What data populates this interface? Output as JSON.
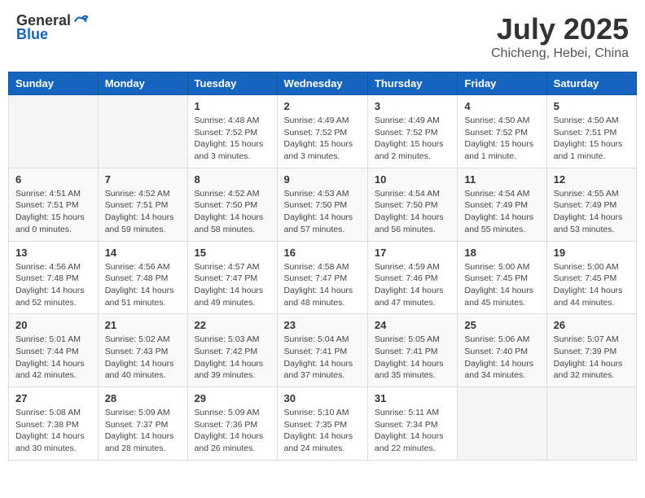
{
  "header": {
    "logo_general": "General",
    "logo_blue": "Blue",
    "month": "July 2025",
    "location": "Chicheng, Hebei, China"
  },
  "weekdays": [
    "Sunday",
    "Monday",
    "Tuesday",
    "Wednesday",
    "Thursday",
    "Friday",
    "Saturday"
  ],
  "weeks": [
    [
      {
        "day": "",
        "info": ""
      },
      {
        "day": "",
        "info": ""
      },
      {
        "day": "1",
        "info": "Sunrise: 4:48 AM\nSunset: 7:52 PM\nDaylight: 15 hours and 3 minutes."
      },
      {
        "day": "2",
        "info": "Sunrise: 4:49 AM\nSunset: 7:52 PM\nDaylight: 15 hours and 3 minutes."
      },
      {
        "day": "3",
        "info": "Sunrise: 4:49 AM\nSunset: 7:52 PM\nDaylight: 15 hours and 2 minutes."
      },
      {
        "day": "4",
        "info": "Sunrise: 4:50 AM\nSunset: 7:52 PM\nDaylight: 15 hours and 1 minute."
      },
      {
        "day": "5",
        "info": "Sunrise: 4:50 AM\nSunset: 7:51 PM\nDaylight: 15 hours and 1 minute."
      }
    ],
    [
      {
        "day": "6",
        "info": "Sunrise: 4:51 AM\nSunset: 7:51 PM\nDaylight: 15 hours and 0 minutes."
      },
      {
        "day": "7",
        "info": "Sunrise: 4:52 AM\nSunset: 7:51 PM\nDaylight: 14 hours and 59 minutes."
      },
      {
        "day": "8",
        "info": "Sunrise: 4:52 AM\nSunset: 7:50 PM\nDaylight: 14 hours and 58 minutes."
      },
      {
        "day": "9",
        "info": "Sunrise: 4:53 AM\nSunset: 7:50 PM\nDaylight: 14 hours and 57 minutes."
      },
      {
        "day": "10",
        "info": "Sunrise: 4:54 AM\nSunset: 7:50 PM\nDaylight: 14 hours and 56 minutes."
      },
      {
        "day": "11",
        "info": "Sunrise: 4:54 AM\nSunset: 7:49 PM\nDaylight: 14 hours and 55 minutes."
      },
      {
        "day": "12",
        "info": "Sunrise: 4:55 AM\nSunset: 7:49 PM\nDaylight: 14 hours and 53 minutes."
      }
    ],
    [
      {
        "day": "13",
        "info": "Sunrise: 4:56 AM\nSunset: 7:48 PM\nDaylight: 14 hours and 52 minutes."
      },
      {
        "day": "14",
        "info": "Sunrise: 4:56 AM\nSunset: 7:48 PM\nDaylight: 14 hours and 51 minutes."
      },
      {
        "day": "15",
        "info": "Sunrise: 4:57 AM\nSunset: 7:47 PM\nDaylight: 14 hours and 49 minutes."
      },
      {
        "day": "16",
        "info": "Sunrise: 4:58 AM\nSunset: 7:47 PM\nDaylight: 14 hours and 48 minutes."
      },
      {
        "day": "17",
        "info": "Sunrise: 4:59 AM\nSunset: 7:46 PM\nDaylight: 14 hours and 47 minutes."
      },
      {
        "day": "18",
        "info": "Sunrise: 5:00 AM\nSunset: 7:45 PM\nDaylight: 14 hours and 45 minutes."
      },
      {
        "day": "19",
        "info": "Sunrise: 5:00 AM\nSunset: 7:45 PM\nDaylight: 14 hours and 44 minutes."
      }
    ],
    [
      {
        "day": "20",
        "info": "Sunrise: 5:01 AM\nSunset: 7:44 PM\nDaylight: 14 hours and 42 minutes."
      },
      {
        "day": "21",
        "info": "Sunrise: 5:02 AM\nSunset: 7:43 PM\nDaylight: 14 hours and 40 minutes."
      },
      {
        "day": "22",
        "info": "Sunrise: 5:03 AM\nSunset: 7:42 PM\nDaylight: 14 hours and 39 minutes."
      },
      {
        "day": "23",
        "info": "Sunrise: 5:04 AM\nSunset: 7:41 PM\nDaylight: 14 hours and 37 minutes."
      },
      {
        "day": "24",
        "info": "Sunrise: 5:05 AM\nSunset: 7:41 PM\nDaylight: 14 hours and 35 minutes."
      },
      {
        "day": "25",
        "info": "Sunrise: 5:06 AM\nSunset: 7:40 PM\nDaylight: 14 hours and 34 minutes."
      },
      {
        "day": "26",
        "info": "Sunrise: 5:07 AM\nSunset: 7:39 PM\nDaylight: 14 hours and 32 minutes."
      }
    ],
    [
      {
        "day": "27",
        "info": "Sunrise: 5:08 AM\nSunset: 7:38 PM\nDaylight: 14 hours and 30 minutes."
      },
      {
        "day": "28",
        "info": "Sunrise: 5:09 AM\nSunset: 7:37 PM\nDaylight: 14 hours and 28 minutes."
      },
      {
        "day": "29",
        "info": "Sunrise: 5:09 AM\nSunset: 7:36 PM\nDaylight: 14 hours and 26 minutes."
      },
      {
        "day": "30",
        "info": "Sunrise: 5:10 AM\nSunset: 7:35 PM\nDaylight: 14 hours and 24 minutes."
      },
      {
        "day": "31",
        "info": "Sunrise: 5:11 AM\nSunset: 7:34 PM\nDaylight: 14 hours and 22 minutes."
      },
      {
        "day": "",
        "info": ""
      },
      {
        "day": "",
        "info": ""
      }
    ]
  ]
}
